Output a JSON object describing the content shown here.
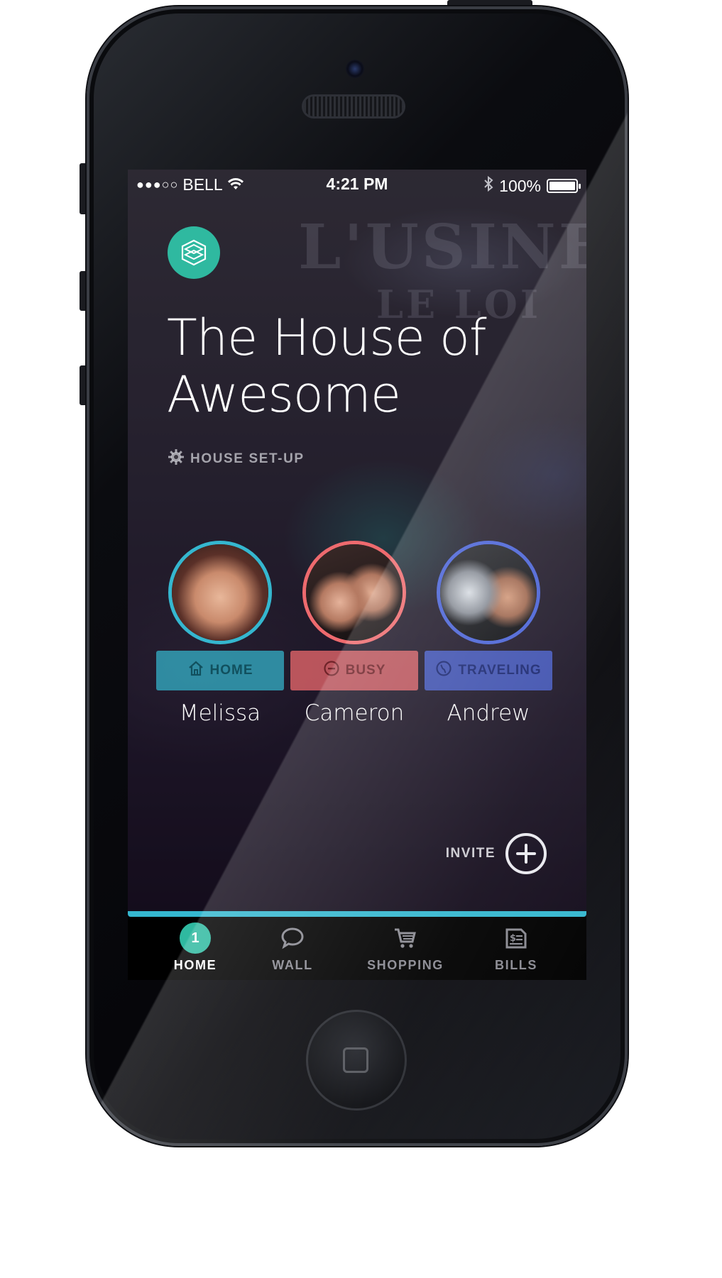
{
  "status_bar": {
    "signal": "●●●○○",
    "carrier": "BELL",
    "time": "4:21 PM",
    "battery": "100%"
  },
  "house": {
    "title": "The House of Awesome",
    "setup_label": "HOUSE SET-UP"
  },
  "members": [
    {
      "name": "Melissa",
      "status": "HOME",
      "status_icon": "house-icon",
      "color": "#35b7cf"
    },
    {
      "name": "Cameron",
      "status": "BUSY",
      "status_icon": "minus-circle-icon",
      "color": "#ee6a6e"
    },
    {
      "name": "Andrew",
      "status": "TRAVELING",
      "status_icon": "globe-icon",
      "color": "#4a63d6"
    }
  ],
  "invite_label": "INVITE",
  "tabs": [
    {
      "label": "HOME",
      "badge": "1",
      "active": true
    },
    {
      "label": "WALL",
      "icon": "speech-bubble-icon",
      "active": false
    },
    {
      "label": "SHOPPING",
      "icon": "cart-icon",
      "active": false
    },
    {
      "label": "BILLS",
      "icon": "bill-icon",
      "active": false
    }
  ],
  "colors": {
    "accent_teal": "#2fb9a0",
    "tab_divider": "#35b7cf",
    "tab_inactive": "#8a8a92"
  }
}
